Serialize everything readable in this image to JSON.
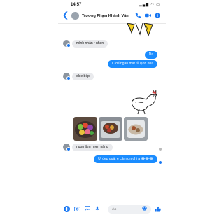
{
  "status_bar": {
    "time": "14:57",
    "icons": "▂▄▆ ◠ ▭"
  },
  "header": {
    "back": "❮",
    "contact_name": "Trương Phạm Khánh Vân"
  },
  "messages": [
    {
      "side": "in",
      "text": "mình nhận r nhen"
    },
    {
      "side": "out",
      "text": "Da"
    },
    {
      "side": "out",
      "text": "C để ngăn mát tủ lạnh nha"
    },
    {
      "side": "in",
      "text": "okie bếp"
    },
    {
      "side": "in",
      "text": "ngon lắm nhen nàng"
    },
    {
      "side": "out",
      "text": "Ui đẹp quá, e cảm ơn chị ạ 😂😂😂"
    }
  ],
  "composer": {
    "placeholder": "Aa"
  },
  "colors": {
    "accent": "#1877f2",
    "outgoing_bubble": "#1a8cff",
    "incoming_bubble": "#e9eaed"
  },
  "icons": [
    "back-icon",
    "phone-icon",
    "video-icon",
    "info-icon",
    "plus-icon",
    "camera-icon",
    "image-icon",
    "mic-icon",
    "emoji-icon",
    "like-icon"
  ]
}
